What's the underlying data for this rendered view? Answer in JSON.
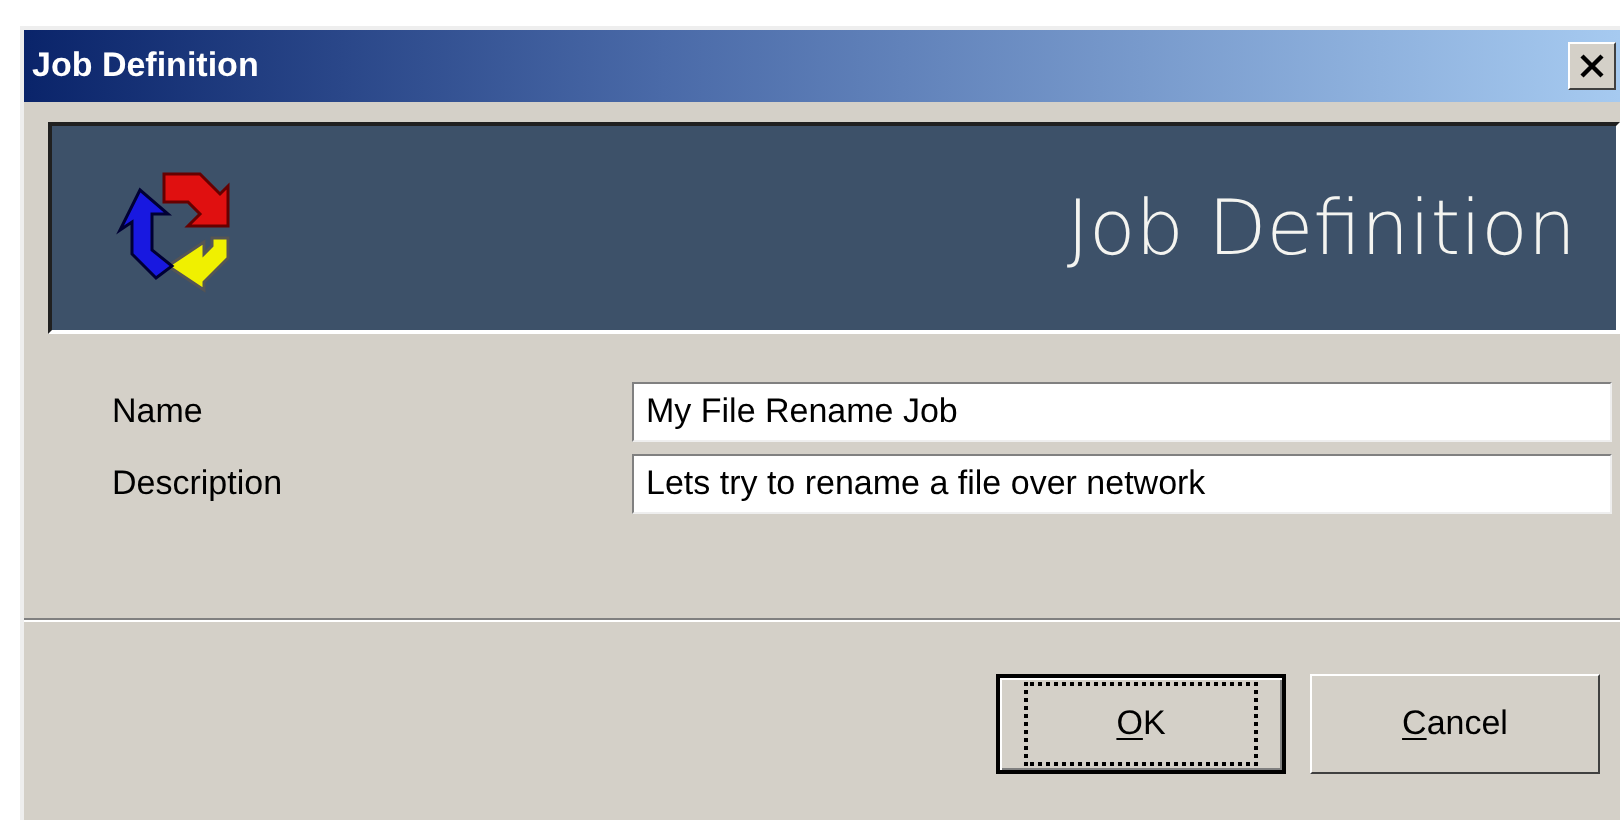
{
  "window": {
    "title": "Job Definition"
  },
  "banner": {
    "title": "Job Definition"
  },
  "fields": [
    {
      "label": "Name",
      "value": "My File Rename Job"
    },
    {
      "label": "Description",
      "value": "Lets try to rename a file over network"
    }
  ],
  "buttons": [
    {
      "label": "OK",
      "default": true,
      "mnemonic_underlined": true
    },
    {
      "label": "Cancel",
      "default": false,
      "mnemonic_underlined": true
    }
  ]
}
